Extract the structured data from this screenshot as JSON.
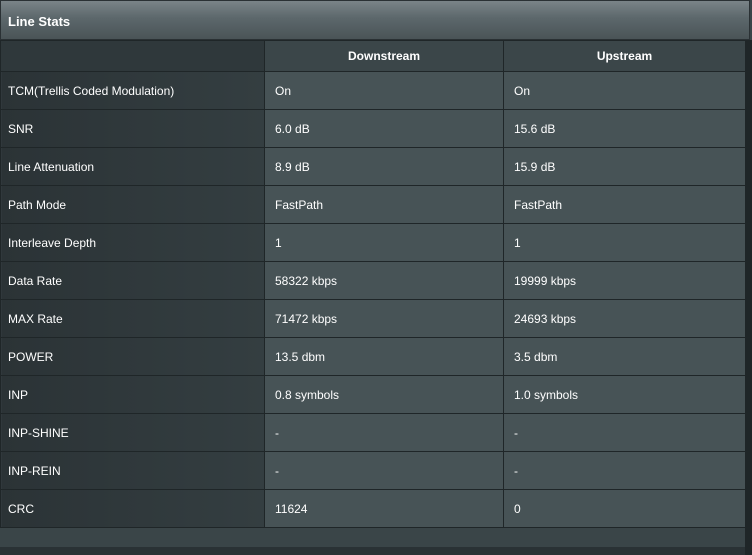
{
  "panel": {
    "title": "Line Stats"
  },
  "table": {
    "headers": [
      "",
      "Downstream",
      "Upstream"
    ],
    "rows": [
      {
        "label": "TCM(Trellis Coded Modulation)",
        "downstream": "On",
        "upstream": "On"
      },
      {
        "label": "SNR",
        "downstream": "6.0 dB",
        "upstream": "15.6 dB"
      },
      {
        "label": "Line Attenuation",
        "downstream": "8.9 dB",
        "upstream": "15.9 dB"
      },
      {
        "label": "Path Mode",
        "downstream": "FastPath",
        "upstream": "FastPath"
      },
      {
        "label": "Interleave Depth",
        "downstream": "1",
        "upstream": "1"
      },
      {
        "label": "Data Rate",
        "downstream": "58322 kbps",
        "upstream": "19999 kbps"
      },
      {
        "label": "MAX Rate",
        "downstream": "71472 kbps",
        "upstream": "24693 kbps"
      },
      {
        "label": "POWER",
        "downstream": "13.5 dbm",
        "upstream": "3.5 dbm"
      },
      {
        "label": "INP",
        "downstream": "0.8 symbols",
        "upstream": "1.0 symbols"
      },
      {
        "label": "INP-SHINE",
        "downstream": "-",
        "upstream": "-"
      },
      {
        "label": "INP-REIN",
        "downstream": "-",
        "upstream": "-"
      },
      {
        "label": "CRC",
        "downstream": "11624",
        "upstream": "0"
      }
    ]
  },
  "colors": {
    "header_text": "#ffffff",
    "cell_text": "#ffffff",
    "value_bg": "#475356",
    "label_bg": "#2f383b"
  }
}
